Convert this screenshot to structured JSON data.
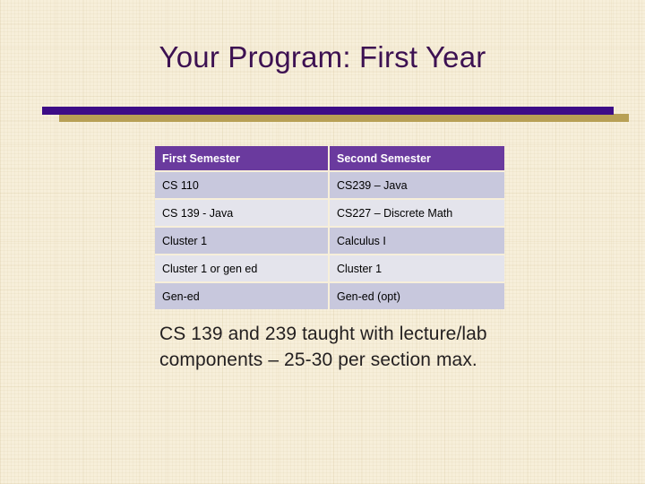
{
  "slide": {
    "title": "Your Program: First Year",
    "colors": {
      "background": "#f7efda",
      "title_text": "#3d1152",
      "divider_purple": "#3d0d87",
      "divider_gold": "#b8a055",
      "table_header_bg": "#6a3a9e",
      "table_header_text": "#ffffff",
      "row_odd_bg": "#c8c8dd",
      "row_even_bg": "#e4e4ec",
      "body_text": "#231f20"
    },
    "table": {
      "headers": [
        "First Semester",
        "Second Semester"
      ],
      "rows": [
        [
          "CS 110",
          "CS239 – Java"
        ],
        [
          "CS 139 - Java",
          "CS227 – Discrete Math"
        ],
        [
          "Cluster 1",
          "Calculus I"
        ],
        [
          "Cluster 1 or gen ed",
          "Cluster 1"
        ],
        [
          "Gen-ed",
          "Gen-ed (opt)"
        ]
      ]
    },
    "note": "CS 139 and 239 taught with lecture/lab components – 25-30 per section max."
  }
}
